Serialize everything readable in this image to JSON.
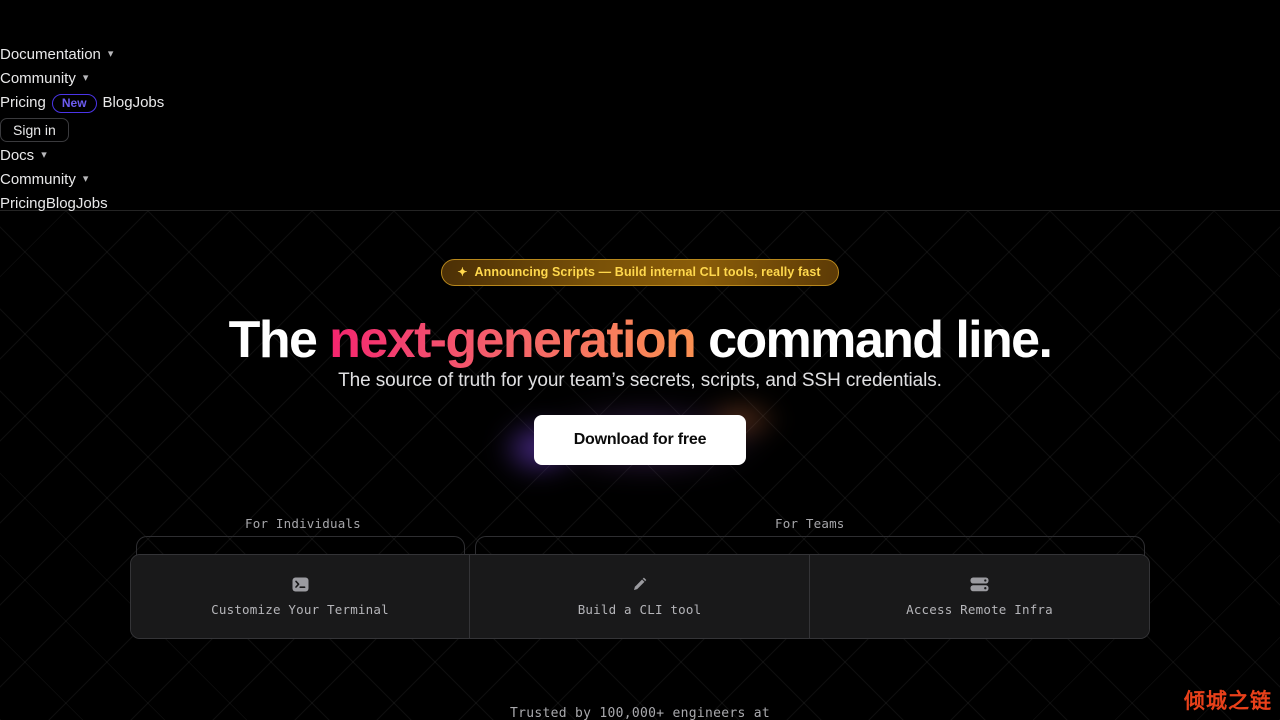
{
  "nav": {
    "documentation": "Documentation",
    "community": "Community",
    "pricing": "Pricing",
    "new_badge": "New",
    "blog": "Blog",
    "jobs": "Jobs",
    "sign_in": "Sign in",
    "docs": "Docs",
    "community2": "Community",
    "pricing2": "Pricing",
    "blog2": "Blog",
    "jobs2": "Jobs",
    "chevron": "⌄",
    "badge_border_color": "#4b35e8",
    "badge_text_color": "#6d5cf0"
  },
  "hero": {
    "announcement": {
      "icon": "sparkle-icon",
      "icon_glyph": "✦",
      "text": "Announcing Scripts — Build internal CLI tools, really fast",
      "text_color": "#ffd84d",
      "border_color": "#b8881c"
    },
    "headline_part1": "The ",
    "headline_highlight": "next-generation",
    "headline_part2": " command line.",
    "headline_gradient_from": "#f5246e",
    "headline_gradient_to": "#fa9052",
    "subhead": "The source of truth for your team’s secrets, scripts, and SSH credentials.",
    "download_label": "Download for free"
  },
  "segments": {
    "individuals": "For Individuals",
    "teams": "For Teams"
  },
  "cards": [
    {
      "icon": "terminal-icon",
      "label": "Customize Your Terminal"
    },
    {
      "icon": "pencil-icon",
      "label": "Build a CLI tool"
    },
    {
      "icon": "server-icon",
      "label": "Access Remote Infra"
    }
  ],
  "trusted": "Trusted by 100,000+ engineers at",
  "watermark": {
    "text": "倾城之链",
    "color": "#e8401a"
  }
}
